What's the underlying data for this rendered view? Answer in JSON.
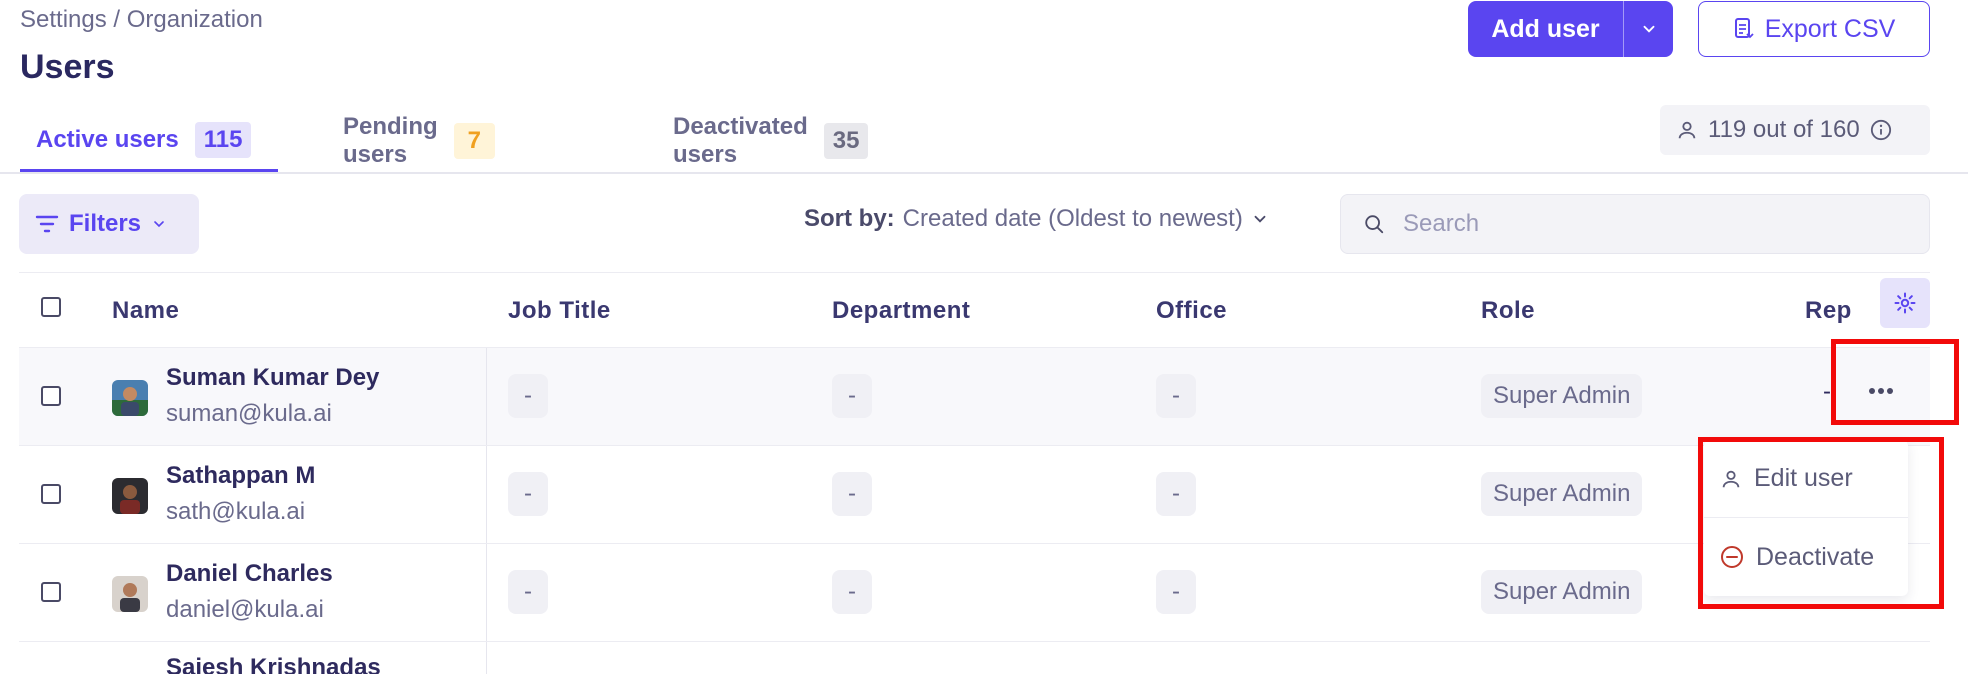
{
  "breadcrumb": "Settings / Organization",
  "page_title": "Users",
  "actions": {
    "add_user_label": "Add user",
    "export_label": "Export CSV"
  },
  "tabs": [
    {
      "label": "Active users",
      "count": "115",
      "active": true
    },
    {
      "label": "Pending users",
      "count": "7",
      "active": false
    },
    {
      "label": "Deactivated users",
      "count": "35",
      "active": false
    }
  ],
  "seats": "119 out of 160",
  "filters_label": "Filters",
  "sort": {
    "label": "Sort by:",
    "value": "Created date (Oldest to newest)"
  },
  "search": {
    "placeholder": "Search",
    "value": ""
  },
  "table": {
    "columns": [
      "Name",
      "Job Title",
      "Department",
      "Office",
      "Role",
      "Rep"
    ],
    "rows": [
      {
        "name": "Suman Kumar Dey",
        "email": "suman@kula.ai",
        "job_title": "-",
        "department": "-",
        "office": "-",
        "role": "Super Admin",
        "rep": "-"
      },
      {
        "name": "Sathappan M",
        "email": "sath@kula.ai",
        "job_title": "-",
        "department": "-",
        "office": "-",
        "role": "Super Admin",
        "rep": "-"
      },
      {
        "name": "Daniel Charles",
        "email": "daniel@kula.ai",
        "job_title": "-",
        "department": "-",
        "office": "-",
        "role": "Super Admin",
        "rep": "-"
      },
      {
        "name": "Sajesh Krishnadas",
        "email": "",
        "job_title": "",
        "department": "",
        "office": "",
        "role": "",
        "rep": ""
      }
    ]
  },
  "row_menu": {
    "edit_label": "Edit user",
    "deactivate_label": "Deactivate"
  },
  "colors": {
    "accent": "#5a45f0",
    "highlight": "#f20a0a",
    "pending": "#f0a020",
    "danger": "#c0392b"
  }
}
